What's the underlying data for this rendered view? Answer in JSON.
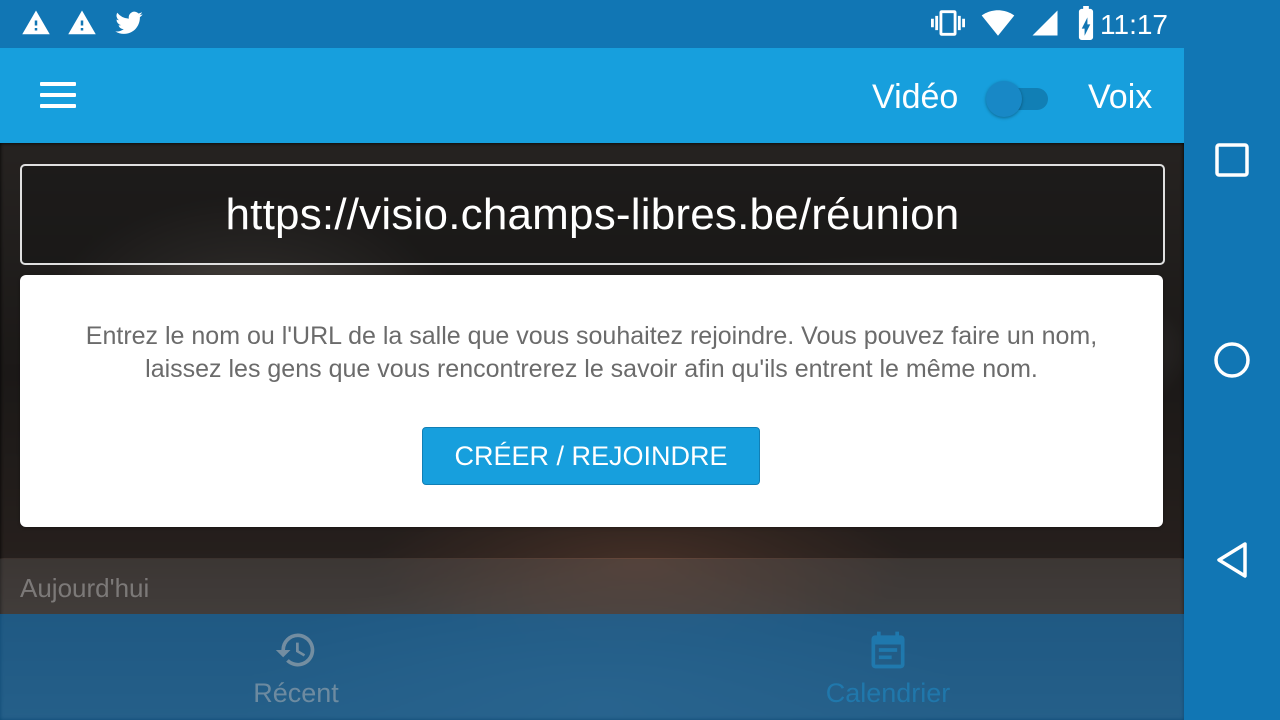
{
  "status_bar": {
    "time": "11:17",
    "notification_icons": [
      "warning-icon",
      "warning-icon",
      "twitter-icon"
    ],
    "system_icons": [
      "vibrate-icon",
      "wifi-icon",
      "signal-icon",
      "battery-charging-icon"
    ]
  },
  "toolbar": {
    "video_label": "Vidéo",
    "voice_label": "Voix",
    "toggle_state": "off"
  },
  "url_field": {
    "value": "https://visio.champs-libres.be/réunion"
  },
  "card": {
    "instructions": "Entrez le nom ou l'URL de la salle que vous souhaitez rejoindre. Vous pouvez faire un nom, laissez les gens que vous rencontrerez le savoir afin qu'ils entrent le même nom.",
    "button_label": "CRÉER / REJOINDRE"
  },
  "list": {
    "section_label": "Aujourd'hui"
  },
  "bottom_nav": {
    "tabs": [
      {
        "label": "Récent",
        "icon": "history-icon"
      },
      {
        "label": "Calendrier",
        "icon": "calendar-icon"
      }
    ]
  },
  "colors": {
    "status_bar": "#1176b4",
    "toolbar": "#179fdd",
    "accent": "#179fdd"
  }
}
